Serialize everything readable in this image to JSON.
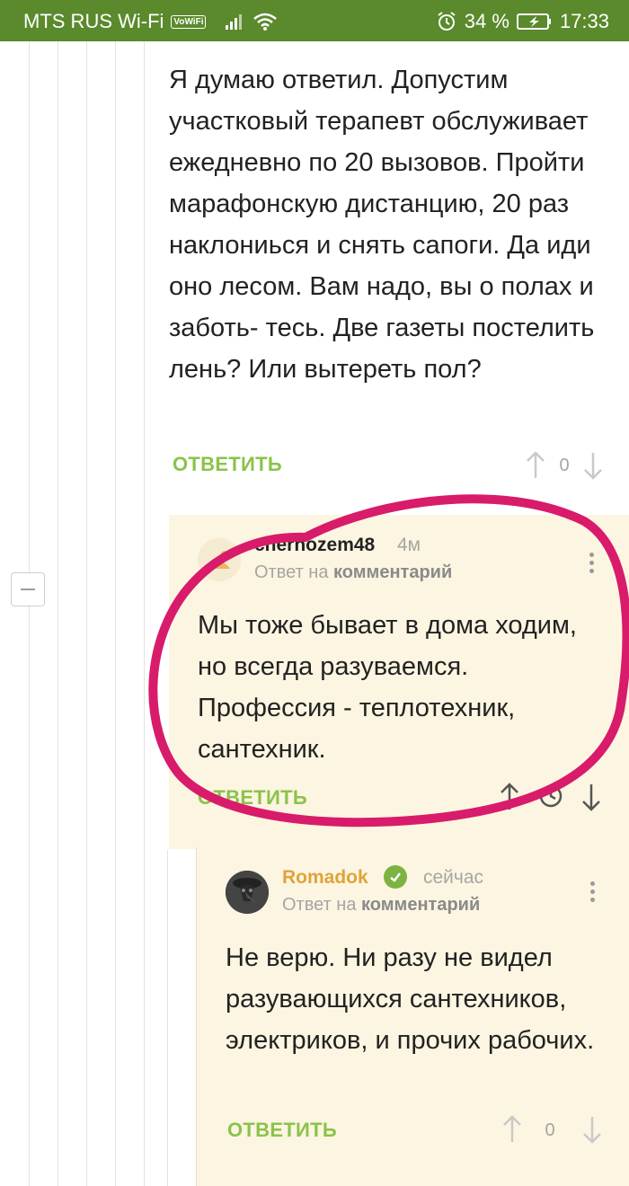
{
  "status_bar": {
    "carrier": "MTS RUS Wi-Fi",
    "volte": "VoWiFi",
    "battery": "34 %",
    "time": "17:33"
  },
  "comment1": {
    "text": "Я думаю ответил. Допустим участковый терапевт обслуживает ежедневно по 20 вызовов. Пройти марафонскую дистанцию, 20 раз наклониься и снять сапоги. Да иди оно лесом. Вам надо, вы о полах и заботь- тесь. Две газеты постелить лень? Или вытереть пол?",
    "reply_label": "ОТВЕТИТЬ",
    "rating": "0"
  },
  "comment2": {
    "author": "chernozem48",
    "time": "4м",
    "reply_to_prefix": "Ответ на",
    "reply_to_target": "комментарий",
    "text": "Мы тоже бывает в дома ходим, но всегда разуваемся. Профессия - теплотехник, сантехник.",
    "reply_label": "ОТВЕТИТЬ"
  },
  "comment3": {
    "author": "Romadok",
    "time": "сейчас",
    "reply_to_prefix": "Ответ на",
    "reply_to_target": "комментарий",
    "text": "Не верю. Ни разу не видел разувающихся сантехников, электриков, и прочих рабочих.",
    "reply_label": "ОТВЕТИТЬ",
    "rating": "0"
  },
  "colors": {
    "status_bar": "#5a8a2c",
    "accent_green": "#8bc34a",
    "author_orange": "#e0a33b",
    "highlight_bg": "#fcf5e1",
    "annotation_pink": "#d81b6a"
  }
}
